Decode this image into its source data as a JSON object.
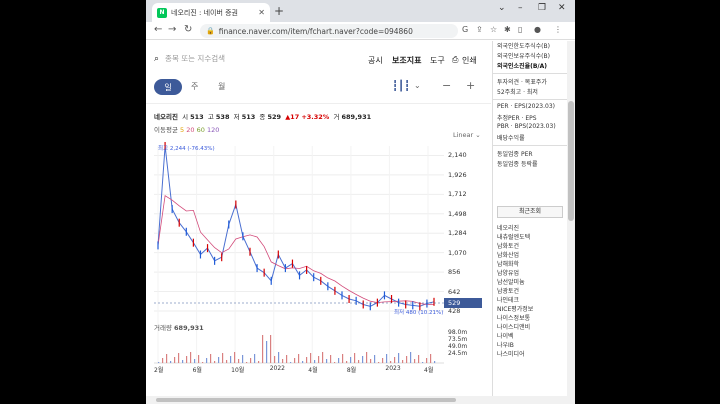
{
  "browser": {
    "tab_title": "네오리진 : 네이버 증권",
    "favicon_letter": "N",
    "new_tab": "+",
    "url": "finance.naver.com/item/fchart.naver?code=094860",
    "controls": {
      "minimize": "–",
      "restore": "❐",
      "close": "✕"
    }
  },
  "toolbar": {
    "search_placeholder": "종목 또는 지수검색",
    "menu": [
      "공시",
      "보조지표",
      "도구",
      "인쇄"
    ]
  },
  "periods": [
    "일",
    "주",
    "월"
  ],
  "stock": {
    "name": "네오리진",
    "open_label": "시",
    "open": "513",
    "high_label": "고",
    "high": "538",
    "low_label": "저",
    "low": "513",
    "close_label": "종",
    "close": "529",
    "change": "▲17",
    "change_pct": "+3.32%",
    "volume_label": "거",
    "volume": "689,931"
  },
  "ma": {
    "label": "이동평균",
    "v5": "5",
    "v20": "20",
    "v60": "60",
    "v120": "120"
  },
  "scale": "Linear",
  "annotations": {
    "high": "최고 2,244 (-76.43%)",
    "low": "최저 480 (10.21%)"
  },
  "current_price": "529",
  "volume_row": {
    "label": "거래량",
    "value": "689,931"
  },
  "right_panel": {
    "items_top": [
      "외국인한도주식수(B)",
      "외국인보유주식수(B)",
      "외국인소진율(B/A)"
    ],
    "items_mid": [
      "투자의견 · 목표주가",
      "52주최고 · 최저"
    ],
    "items_per": [
      "PER · EPS(2023.03)",
      "추정PER · EPS",
      "PBR · BPS(2023.03)",
      "배당수익률"
    ],
    "items_ind": [
      "동일업종 PER",
      "동일업종 등락률"
    ],
    "recent_header": "최근조회",
    "recent": [
      "네오리진",
      "내츄럴엔도텍",
      "남화토건",
      "남화산업",
      "남해화학",
      "남양유업",
      "남선알미늄",
      "남광토건",
      "나인테크",
      "NICE평가정보",
      "나이스정보통",
      "나이스디앤비",
      "나이벡",
      "나우IB",
      "나스미디어"
    ]
  },
  "chart_data": {
    "type": "line",
    "title": "",
    "xlabel": "",
    "ylabel": "",
    "x_ticks": [
      "2월",
      "6월",
      "10월",
      "2022",
      "4월",
      "8월",
      "2023",
      "4월"
    ],
    "y_ticks": [
      2140,
      1926,
      1712,
      1498,
      1284,
      1070,
      856,
      642,
      428
    ],
    "ylim": [
      428,
      2244
    ],
    "volume_ticks": [
      "98.0m",
      "73.5m",
      "49.0m",
      "24.5m"
    ],
    "series": [
      {
        "name": "",
        "values": [
          1150,
          2244,
          1550,
          1400,
          1300,
          1180,
          1050,
          1120,
          980,
          1020,
          1380,
          1600,
          1250,
          1080,
          900,
          850,
          760,
          1050,
          900,
          950,
          820,
          880,
          800,
          760,
          700,
          650,
          600,
          560,
          540,
          500,
          480,
          520,
          600,
          560,
          520,
          500,
          490,
          480,
          510,
          529
        ]
      }
    ],
    "grid": true,
    "legend": "none"
  },
  "colors": {
    "accent": "#3d5a99",
    "up": "#d60000",
    "down": "#1f5bd8"
  }
}
